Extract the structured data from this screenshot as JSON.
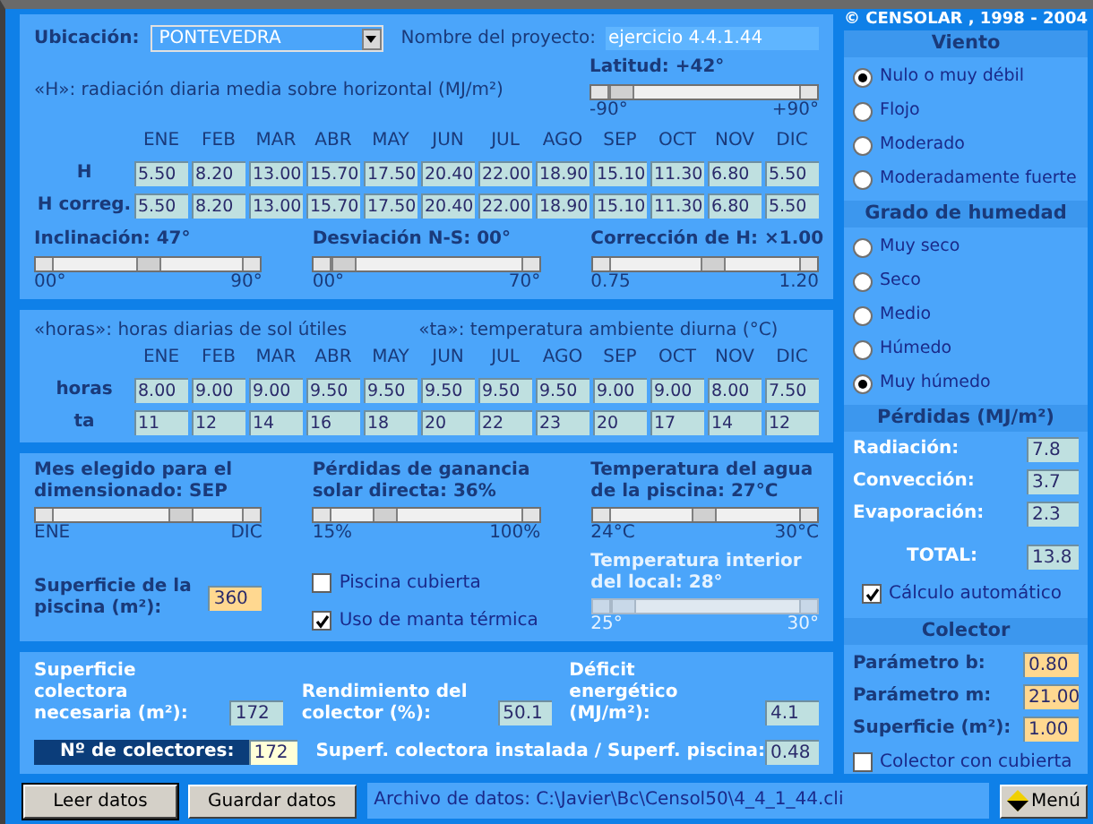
{
  "location": {
    "label": "Ubicación:",
    "value": "PONTEVEDRA"
  },
  "project": {
    "label": "Nombre del proyecto:",
    "value": "ejercicio 4.4.1.44"
  },
  "radiation_title": "«H»: radiación diaria media sobre horizontal (MJ/m²)",
  "latitude": {
    "label": "Latitud: +42°",
    "min": "-90°",
    "max": "+90°",
    "level": 0
  },
  "months": [
    "ENE",
    "FEB",
    "MAR",
    "ABR",
    "MAY",
    "JUN",
    "JUL",
    "AGO",
    "SEP",
    "OCT",
    "NOV",
    "DIC"
  ],
  "h_rows": [
    {
      "label": "H",
      "values": [
        "5.50",
        "8.20",
        "13.00",
        "15.70",
        "17.50",
        "20.40",
        "22.00",
        "18.90",
        "15.10",
        "11.30",
        "6.80",
        "5.50"
      ]
    },
    {
      "label": "H correg.",
      "values": [
        "5.50",
        "8.20",
        "13.00",
        "15.70",
        "17.50",
        "20.40",
        "22.00",
        "18.90",
        "15.10",
        "11.30",
        "6.80",
        "5.50"
      ]
    }
  ],
  "sliders_top": [
    {
      "label": "Inclinación: 47°",
      "min": "00°",
      "max": "90°",
      "level": 0.5
    },
    {
      "label": "Desviación N-S: 00°",
      "min": "00°",
      "max": "70°",
      "level": 0
    },
    {
      "label": "Corrección de H: ×1.00",
      "min": "0.75",
      "max": "1.20",
      "level": 0.55
    }
  ],
  "hours_title": "«horas»: horas diarias de sol útiles",
  "ta_title": "«ta»: temperatura ambiente diurna (°C)",
  "months_2": [
    "ENE",
    "FEB",
    "MAR",
    "ABR",
    "MAY",
    "JUN",
    "JUL",
    "AGO",
    "SEP",
    "OCT",
    "NOV",
    "DIC"
  ],
  "hours_rows": [
    {
      "label": "horas",
      "values": [
        "8.00",
        "9.00",
        "9.00",
        "9.50",
        "9.50",
        "9.50",
        "9.50",
        "9.50",
        "9.00",
        "9.00",
        "8.00",
        "7.50"
      ]
    },
    {
      "label": "ta",
      "values": [
        "11",
        "12",
        "14",
        "16",
        "18",
        "20",
        "22",
        "23",
        "20",
        "17",
        "14",
        "12"
      ]
    }
  ],
  "sliders_mid": [
    {
      "label": "Mes elegido para el dimensionado: SEP",
      "min": "ENE",
      "max": "DIC",
      "level": 0.7
    },
    {
      "label": "Pérdidas de ganancia solar directa: 36%",
      "min": "15%",
      "max": "100%",
      "level": 0.25
    },
    {
      "label": "Temperatura del agua de la piscina: 27°C",
      "min": "24°C",
      "max": "30°C",
      "level": 0.5
    }
  ],
  "pool_area": {
    "label": "Superficie de la piscina (m²):",
    "value": "360"
  },
  "checkboxes": [
    {
      "label": "Piscina cubierta",
      "checked": false
    },
    {
      "label": "Uso de manta térmica",
      "checked": true
    }
  ],
  "interior_temp": {
    "label": "Temperatura interior del local: 28°",
    "min": "25°",
    "max": "30°",
    "level": 0,
    "disabled": true
  },
  "results": [
    {
      "label": "Superficie colectora necesaria (m²):",
      "value": "172"
    },
    {
      "label": "Rendimiento del colector (%):",
      "value": "50.1"
    },
    {
      "label": "Déficit energético (MJ/m²):",
      "value": "4.1"
    }
  ],
  "collectors": {
    "label": "Nº de colectores:",
    "value": "172"
  },
  "ratio": {
    "label": "Superf. colectora instalada / Superf. piscina:",
    "value": "0.48"
  },
  "buttons": [
    "Leer datos",
    "Guardar datos"
  ],
  "file": "Archivo de datos: C:\\Javier\\Bc\\Censol50\\4_4_1_44.cli",
  "menu": "Menú",
  "copyright": "© CENSOLAR , 1998 - 2004",
  "wind": {
    "title": "Viento",
    "options": [
      {
        "label": "Nulo o muy débil",
        "selected": true
      },
      {
        "label": "Flojo",
        "selected": false
      },
      {
        "label": "Moderado",
        "selected": false
      },
      {
        "label": "Moderadamente fuerte",
        "selected": false
      }
    ]
  },
  "humidity": {
    "title": "Grado de humedad",
    "options": [
      {
        "label": "Muy seco",
        "selected": false
      },
      {
        "label": "Seco",
        "selected": false
      },
      {
        "label": "Medio",
        "selected": false
      },
      {
        "label": "Húmedo",
        "selected": false
      },
      {
        "label": "Muy húmedo",
        "selected": true
      }
    ]
  },
  "losses": {
    "title": "Pérdidas (MJ/m²)",
    "rows": [
      {
        "label": "Radiación:",
        "value": "7.8"
      },
      {
        "label": "Convección:",
        "value": "3.7"
      },
      {
        "label": "Evaporación:",
        "value": "2.3"
      }
    ],
    "total": {
      "label": "TOTAL:",
      "value": "13.8"
    },
    "auto": {
      "label": "Cálculo automático",
      "checked": true
    }
  },
  "collector": {
    "title": "Colector",
    "params": [
      {
        "label": "Parámetro b:",
        "value": "0.80"
      },
      {
        "label": "Parámetro m:",
        "value": "21.00"
      },
      {
        "label": "Superficie (m²):",
        "value": "1.00"
      }
    ],
    "covered": {
      "label": "Colector con cubierta",
      "checked": false
    }
  }
}
